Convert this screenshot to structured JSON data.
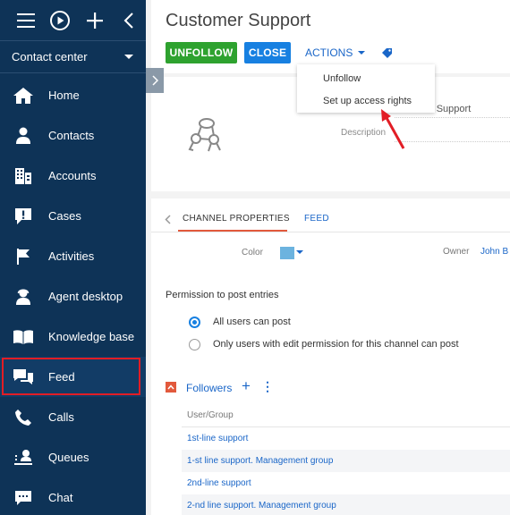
{
  "sidebar": {
    "top_icons": [
      "menu-icon",
      "play-icon",
      "plus-icon",
      "chevron-left-icon"
    ],
    "workplace": "Contact center",
    "items": [
      {
        "label": "Home",
        "icon": "home-icon"
      },
      {
        "label": "Contacts",
        "icon": "person-icon"
      },
      {
        "label": "Accounts",
        "icon": "building-icon"
      },
      {
        "label": "Cases",
        "icon": "cases-icon"
      },
      {
        "label": "Activities",
        "icon": "flag-icon"
      },
      {
        "label": "Agent desktop",
        "icon": "agent-icon"
      },
      {
        "label": "Knowledge base",
        "icon": "book-icon"
      },
      {
        "label": "Feed",
        "icon": "feed-icon",
        "active": true
      },
      {
        "label": "Calls",
        "icon": "phone-icon"
      },
      {
        "label": "Queues",
        "icon": "queue-icon"
      },
      {
        "label": "Chat",
        "icon": "chat-icon"
      }
    ],
    "active_highlight_color": "#e21d25"
  },
  "header": {
    "title": "Customer Support",
    "unfollow_label": "UNFOLLOW",
    "close_label": "CLOSE",
    "actions_label": "ACTIONS",
    "tag_icon": "tag-icon"
  },
  "actions_menu": {
    "items": [
      "Unfollow",
      "Set up access rights"
    ]
  },
  "profile": {
    "name_value": "r Support",
    "description_label": "Description"
  },
  "tabs": [
    {
      "label": "CHANNEL PROPERTIES",
      "active": true
    },
    {
      "label": "FEED",
      "active": false
    }
  ],
  "channel": {
    "color_label": "Color",
    "color_value": "#6cb3df",
    "owner_label": "Owner",
    "owner_value": "John B"
  },
  "permissions": {
    "label": "Permission to post entries",
    "options": [
      {
        "label": "All users can post",
        "selected": true
      },
      {
        "label": "Only users with edit permission for this channel can post",
        "selected": false
      }
    ]
  },
  "followers": {
    "title": "Followers",
    "column_header": "User/Group",
    "rows": [
      "1st-line support",
      "1-st line support. Management group",
      "2nd-line support",
      "2-nd line support. Management group"
    ]
  },
  "colors": {
    "sidebar_bg": "#0e3357",
    "green_button": "#2ea22f",
    "blue_button": "#1780e1",
    "accent_orange": "#e2593c",
    "link_blue": "#1a66c8"
  }
}
